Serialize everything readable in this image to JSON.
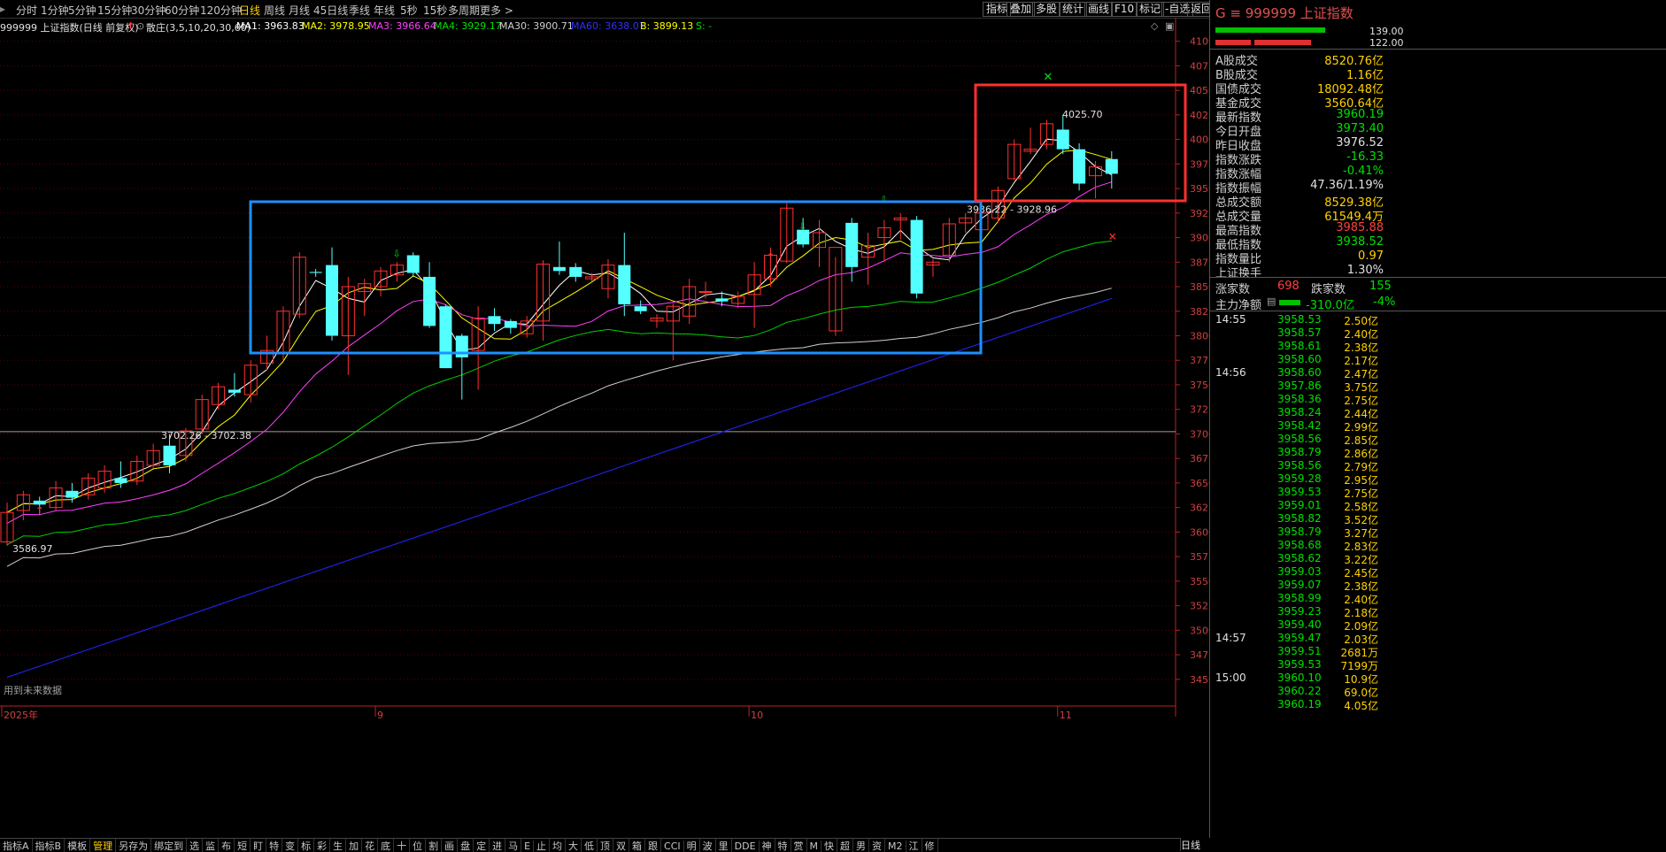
{
  "toolbar": {
    "timeframes": [
      "分时",
      "1分钟",
      "5分钟",
      "15分钟",
      "30分钟",
      "60分钟",
      "120分钟",
      "日线",
      "周线",
      "月线",
      "45日线",
      "季线",
      "年线",
      "5秒",
      "15秒",
      "多周期",
      "更多 >"
    ],
    "active_index": 7,
    "right_buttons": [
      "指标",
      "叠加",
      "多股",
      "统计",
      "画线",
      "F10",
      "标记",
      "-自选",
      "返回"
    ]
  },
  "infobar": {
    "title": "999999 上证指数(日线 前复权)",
    "indicator": "散庄(3,5,10,20,30,60)",
    "ma1": "MA1: 3963.83",
    "ma2": "MA2: 3978.95",
    "ma3": "MA3: 3966.64",
    "ma4": "MA4: 3929.17",
    "ma30": "MA30: 3900.71",
    "ma60": "MA60: 3638.07",
    "b": "B: 3899.13",
    "s": "S: -",
    "colors": {
      "ma1": "#ffffff",
      "ma2": "#ffff00",
      "ma3": "#ff40ff",
      "ma4": "#00e000",
      "ma30": "#d0d0d0",
      "ma60": "#2020ff",
      "b": "#ffff00",
      "s": "#00e000"
    }
  },
  "chart_data": {
    "type": "candlestick",
    "ylim": [
      3430,
      4115
    ],
    "yticks": [
      3450,
      3475,
      3500,
      3525,
      3550,
      3575,
      3600,
      3625,
      3650,
      3675,
      3700,
      3725,
      3750,
      3775,
      3800,
      3825,
      3850,
      3875,
      3900,
      3925,
      3950,
      3975,
      4000,
      4025,
      4050,
      4075,
      4100
    ],
    "candles": [
      [
        3590,
        3630,
        3586,
        3620
      ],
      [
        3622,
        3642,
        3612,
        3638
      ],
      [
        3632,
        3636,
        3618,
        3628
      ],
      [
        3625,
        3652,
        3622,
        3645
      ],
      [
        3642,
        3650,
        3630,
        3635
      ],
      [
        3638,
        3660,
        3633,
        3655
      ],
      [
        3645,
        3668,
        3640,
        3662
      ],
      [
        3655,
        3672,
        3645,
        3650
      ],
      [
        3652,
        3678,
        3648,
        3672
      ],
      [
        3668,
        3690,
        3665,
        3683
      ],
      [
        3688,
        3700,
        3660,
        3668
      ],
      [
        3678,
        3706,
        3672,
        3703
      ],
      [
        3705,
        3740,
        3700,
        3735
      ],
      [
        3730,
        3752,
        3725,
        3748
      ],
      [
        3745,
        3762,
        3738,
        3742
      ],
      [
        3740,
        3775,
        3732,
        3770
      ],
      [
        3772,
        3800,
        3765,
        3785
      ],
      [
        3783,
        3830,
        3775,
        3825
      ],
      [
        3822,
        3885,
        3818,
        3880
      ],
      [
        3865,
        3868,
        3860,
        3864
      ],
      [
        3872,
        3890,
        3795,
        3800
      ],
      [
        3800,
        3860,
        3760,
        3850
      ],
      [
        3845,
        3858,
        3820,
        3853
      ],
      [
        3850,
        3870,
        3840,
        3866
      ],
      [
        3862,
        3875,
        3855,
        3872
      ],
      [
        3882,
        3885,
        3860,
        3864
      ],
      [
        3860,
        3875,
        3808,
        3810
      ],
      [
        3830,
        3832,
        3770,
        3767
      ],
      [
        3800,
        3802,
        3735,
        3778
      ],
      [
        3785,
        3830,
        3745,
        3818
      ],
      [
        3820,
        3828,
        3805,
        3812
      ],
      [
        3815,
        3817,
        3802,
        3808
      ],
      [
        3802,
        3820,
        3798,
        3815
      ],
      [
        3815,
        3877,
        3795,
        3873
      ],
      [
        3870,
        3896,
        3862,
        3866
      ],
      [
        3870,
        3874,
        3855,
        3860
      ],
      [
        3858,
        3864,
        3855,
        3860
      ],
      [
        3848,
        3878,
        3838,
        3872
      ],
      [
        3872,
        3905,
        3820,
        3832
      ],
      [
        3830,
        3836,
        3822,
        3825
      ],
      [
        3815,
        3822,
        3808,
        3818
      ],
      [
        3815,
        3833,
        3775,
        3830
      ],
      [
        3820,
        3858,
        3812,
        3850
      ],
      [
        3845,
        3855,
        3838,
        3845
      ],
      [
        3838,
        3845,
        3830,
        3835
      ],
      [
        3833,
        3845,
        3828,
        3840
      ],
      [
        3842,
        3875,
        3808,
        3862
      ],
      [
        3858,
        3890,
        3850,
        3882
      ],
      [
        3876,
        3935,
        3874,
        3930
      ],
      [
        3908,
        3920,
        3890,
        3893
      ],
      [
        3890,
        3918,
        3870,
        3905
      ],
      [
        3805,
        3880,
        3800,
        3890
      ],
      [
        3915,
        3920,
        3855,
        3870
      ],
      [
        3880,
        3905,
        3852,
        3892
      ],
      [
        3900,
        3918,
        3875,
        3910
      ],
      [
        3918,
        3925,
        3898,
        3920
      ],
      [
        3918,
        3922,
        3838,
        3843
      ],
      [
        3872,
        3878,
        3860,
        3875
      ],
      [
        3882,
        3920,
        3875,
        3914
      ],
      [
        3915,
        3925,
        3905,
        3920
      ],
      [
        3908,
        3930,
        3900,
        3925
      ],
      [
        3920,
        3952,
        3915,
        3948
      ],
      [
        3960,
        4000,
        3958,
        3995
      ],
      [
        3988,
        4012,
        3985,
        3990
      ],
      [
        3995,
        4020,
        3990,
        4016
      ],
      [
        4010,
        4025,
        3985,
        3990
      ],
      [
        3990,
        3996,
        3948,
        3955
      ],
      [
        3963,
        3978,
        3940,
        3972
      ],
      [
        3980,
        3988,
        3950,
        3965
      ]
    ],
    "annotations": {
      "low_label": "3586.97",
      "hline_label": "3702.26 - 3702.38",
      "high_label": "4025.70",
      "mid_label": "3936.22 - 3928.96",
      "no_data_label": "用到未来数据"
    },
    "xlabels": [
      {
        "i": 0,
        "t": "2025年"
      },
      {
        "i": 23,
        "t": "9"
      },
      {
        "i": 46,
        "t": "10"
      },
      {
        "i": 65,
        "t": "11"
      }
    ]
  },
  "panel": {
    "code": "999999",
    "name": "上证指数",
    "bar1_value": "139.00",
    "bar2_value": "122.00",
    "stats": [
      {
        "label": "A股成交",
        "value": "8520.76亿",
        "color": "#ffd200"
      },
      {
        "label": "B股成交",
        "value": "1.16亿",
        "color": "#ffd200"
      },
      {
        "label": "国债成交",
        "value": "18092.48亿",
        "color": "#ffd200"
      },
      {
        "label": "基金成交",
        "value": "3560.64亿",
        "color": "#ffd200"
      },
      {
        "label": "最新指数",
        "value": "3960.19",
        "color": "#00e000"
      },
      {
        "label": "今日开盘",
        "value": "3973.40",
        "color": "#00e000"
      },
      {
        "label": "昨日收盘",
        "value": "3976.52",
        "color": "#e0e0e0"
      },
      {
        "label": "指数涨跌",
        "value": "-16.33",
        "color": "#00e000"
      },
      {
        "label": "指数涨幅",
        "value": "-0.41%",
        "color": "#00e000"
      },
      {
        "label": "指数振幅",
        "value": "47.36/1.19%",
        "color": "#e0e0e0"
      },
      {
        "label": "总成交额",
        "value": "8529.38亿",
        "color": "#ffd200"
      },
      {
        "label": "总成交量",
        "value": "61549.4万",
        "color": "#ffd200"
      },
      {
        "label": "最高指数",
        "value": "3985.88",
        "color": "#ff4040"
      },
      {
        "label": "最低指数",
        "value": "3938.52",
        "color": "#00e000"
      },
      {
        "label": "指数量比",
        "value": "0.97",
        "color": "#ffd200"
      },
      {
        "label": "上证换手",
        "value": "1.30%",
        "color": "#e0e0e0"
      }
    ],
    "up_label": "涨家数",
    "up_value": "698",
    "down_label": "跌家数",
    "down_value": "155",
    "main_flow_label": "主力净额",
    "main_flow_value": "-310.0亿",
    "main_flow_pct": "-4%",
    "ticks": [
      {
        "time": "14:55",
        "price": "3958.53",
        "vol": "2.50亿"
      },
      {
        "time": "",
        "price": "3958.57",
        "vol": "2.40亿"
      },
      {
        "time": "",
        "price": "3958.61",
        "vol": "2.38亿"
      },
      {
        "time": "",
        "price": "3958.60",
        "vol": "2.17亿"
      },
      {
        "time": "14:56",
        "price": "3958.60",
        "vol": "2.47亿"
      },
      {
        "time": "",
        "price": "3957.86",
        "vol": "3.75亿"
      },
      {
        "time": "",
        "price": "3958.36",
        "vol": "2.75亿"
      },
      {
        "time": "",
        "price": "3958.24",
        "vol": "2.44亿"
      },
      {
        "time": "",
        "price": "3958.42",
        "vol": "2.99亿"
      },
      {
        "time": "",
        "price": "3958.56",
        "vol": "2.85亿"
      },
      {
        "time": "",
        "price": "3958.79",
        "vol": "2.86亿"
      },
      {
        "time": "",
        "price": "3958.56",
        "vol": "2.79亿"
      },
      {
        "time": "",
        "price": "3959.28",
        "vol": "2.95亿"
      },
      {
        "time": "",
        "price": "3959.53",
        "vol": "2.75亿"
      },
      {
        "time": "",
        "price": "3959.01",
        "vol": "2.58亿"
      },
      {
        "time": "",
        "price": "3958.82",
        "vol": "3.52亿"
      },
      {
        "time": "",
        "price": "3958.79",
        "vol": "3.27亿"
      },
      {
        "time": "",
        "price": "3958.68",
        "vol": "2.83亿"
      },
      {
        "time": "",
        "price": "3958.62",
        "vol": "3.22亿"
      },
      {
        "time": "",
        "price": "3959.03",
        "vol": "2.45亿"
      },
      {
        "time": "",
        "price": "3959.07",
        "vol": "2.38亿"
      },
      {
        "time": "",
        "price": "3958.99",
        "vol": "2.40亿"
      },
      {
        "time": "",
        "price": "3959.23",
        "vol": "2.18亿"
      },
      {
        "time": "",
        "price": "3959.40",
        "vol": "2.09亿"
      },
      {
        "time": "14:57",
        "price": "3959.47",
        "vol": "2.03亿"
      },
      {
        "time": "",
        "price": "3959.51",
        "vol": "2681万"
      },
      {
        "time": "",
        "price": "3959.53",
        "vol": "7199万"
      },
      {
        "time": "15:00",
        "price": "3960.10",
        "vol": "10.9亿"
      },
      {
        "time": "",
        "price": "3960.22",
        "vol": "69.0亿"
      },
      {
        "time": "",
        "price": "3960.19",
        "vol": "4.05亿"
      }
    ]
  },
  "bottombar": {
    "items": [
      "指标A",
      "指标B",
      "模板",
      "管理",
      "另存为",
      "绑定到",
      "选",
      "监",
      "布",
      "短",
      "盯",
      "特",
      "变",
      "标",
      "彩",
      "生",
      "加",
      "花",
      "底",
      "十",
      "位",
      "割",
      "画",
      "盘",
      "定",
      "进",
      "马",
      "E",
      "止",
      "均",
      "大",
      "低",
      "顶",
      "双",
      "箱",
      "跟",
      "CCI",
      "明",
      "波",
      "里",
      "DDE",
      "神",
      "特",
      "赏",
      "M",
      "快",
      "超",
      "男",
      "资",
      "M2",
      "江",
      "修"
    ],
    "active_index": 3,
    "corner_label": "日线"
  }
}
